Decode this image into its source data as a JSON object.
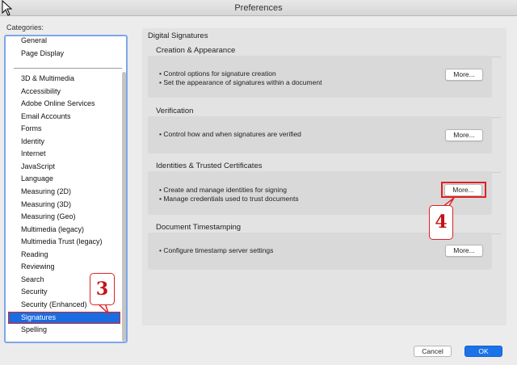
{
  "window": {
    "title": "Preferences"
  },
  "categories": {
    "label": "Categories:",
    "top_items": [
      "General",
      "Page Display"
    ],
    "items": [
      "3D & Multimedia",
      "Accessibility",
      "Adobe Online Services",
      "Email Accounts",
      "Forms",
      "Identity",
      "Internet",
      "JavaScript",
      "Language",
      "Measuring (2D)",
      "Measuring (3D)",
      "Measuring (Geo)",
      "Multimedia (legacy)",
      "Multimedia Trust (legacy)",
      "Reading",
      "Reviewing",
      "Search",
      "Security",
      "Security (Enhanced)"
    ],
    "selected": "Signatures",
    "after_selected": [
      "Spelling"
    ]
  },
  "main": {
    "title": "Digital Signatures",
    "sections": [
      {
        "heading": "Creation & Appearance",
        "bullets": [
          "• Control options for signature creation",
          "• Set the appearance of signatures within a document"
        ],
        "button": "More..."
      },
      {
        "heading": "Verification",
        "bullets": [
          "• Control how and when signatures are verified"
        ],
        "button": "More..."
      },
      {
        "heading": "Identities & Trusted Certificates",
        "bullets": [
          "• Create and manage identities for signing",
          "• Manage credentials used to trust documents"
        ],
        "button": "More..."
      },
      {
        "heading": "Document Timestamping",
        "bullets": [
          "• Configure timestamp server settings"
        ],
        "button": "More..."
      }
    ]
  },
  "annotations": {
    "step3": "3",
    "step4": "4"
  },
  "footer": {
    "cancel": "Cancel",
    "ok": "OK"
  },
  "colors": {
    "accent": "#1a73e8",
    "selection": "#1a6de0",
    "annotation_red": "#d22222"
  }
}
